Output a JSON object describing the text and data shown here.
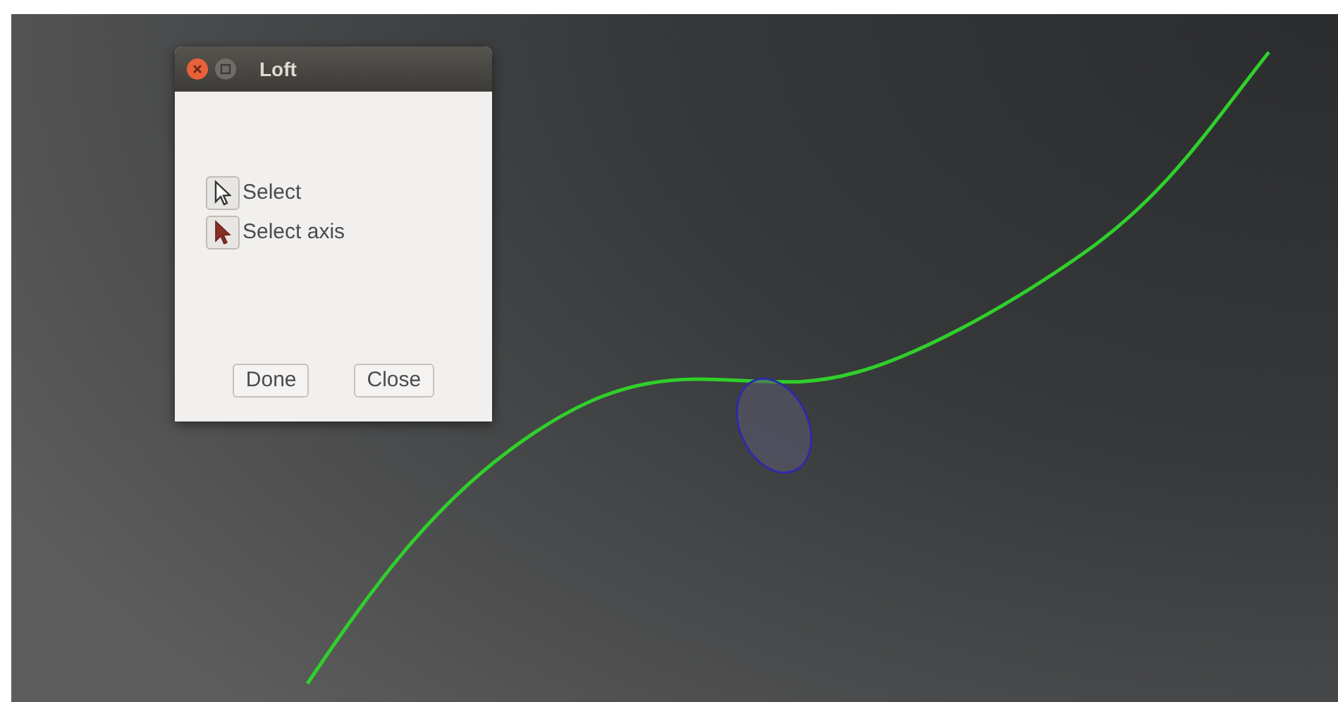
{
  "window": {
    "title": "Loft"
  },
  "tools": [
    {
      "label": "Select",
      "kind": "select"
    },
    {
      "label": "Select axis",
      "kind": "axis"
    }
  ],
  "buttons": [
    "Done",
    "Close"
  ]
}
